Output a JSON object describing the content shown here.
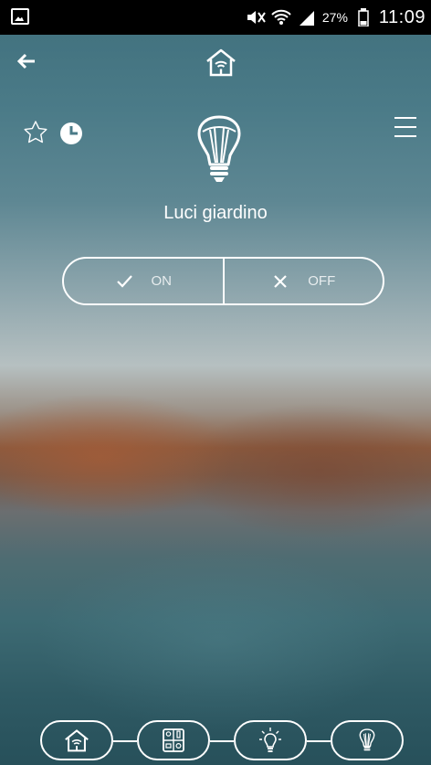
{
  "status_bar": {
    "battery_percent": "27%",
    "time": "11:09",
    "icons": [
      "gallery-icon",
      "mute-icon",
      "wifi-icon",
      "signal-icon",
      "battery-icon"
    ]
  },
  "top_bar": {
    "back_icon": "arrow-left-icon",
    "home_icon": "home-wifi-icon"
  },
  "actions": {
    "favorite_icon": "star-icon",
    "schedule_icon": "clock-icon",
    "menu_icon": "hamburger-menu-icon"
  },
  "device": {
    "icon": "lightbulb-icon",
    "name": "Luci giardino"
  },
  "toggle": {
    "on_label": "ON",
    "off_label": "OFF",
    "on_icon": "check-icon",
    "off_icon": "x-icon"
  },
  "breadcrumb_nav": {
    "items": [
      "home-wifi-icon",
      "switch-panel-icon",
      "light-idea-icon",
      "lightbulb-icon"
    ]
  },
  "colors": {
    "foreground": "#ffffff",
    "status_bar_bg": "#000000"
  }
}
